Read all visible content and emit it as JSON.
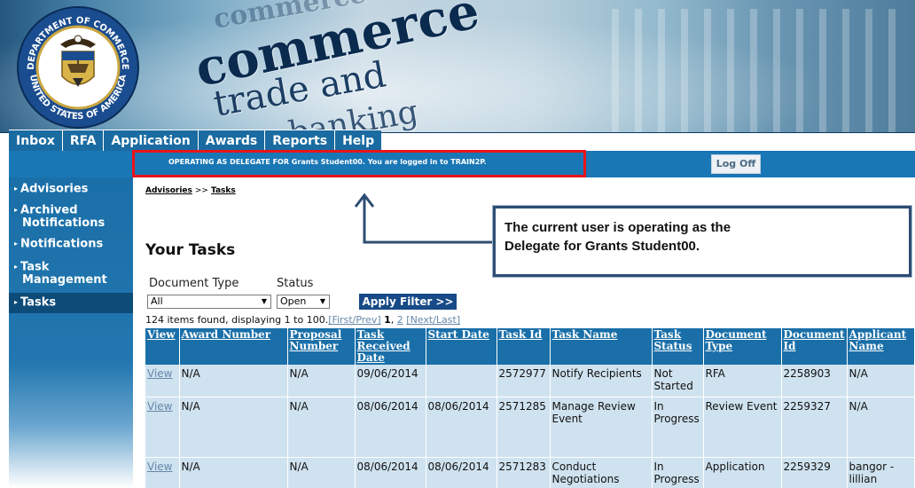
{
  "tabs": [
    {
      "label": "Inbox"
    },
    {
      "label": "RFA"
    },
    {
      "label": "Application"
    },
    {
      "label": "Awards"
    },
    {
      "label": "Reports"
    },
    {
      "label": "Help"
    }
  ],
  "banner": {
    "seal_top_text": "DEPARTMENT OF COMMERCE",
    "seal_bottom_text": "UNITED STATES OF AMERICA",
    "word_commerce": "commerce",
    "word_trade": "trade and",
    "word_banking": "banking"
  },
  "delegate_bar": {
    "message": "OPERATING AS DELEGATE FOR Grants Student00. You are logged in to TRAIN2P.",
    "logoff_label": "Log Off"
  },
  "sidebar": {
    "items": [
      {
        "line1": "Advisories",
        "line2": ""
      },
      {
        "line1": "Archived",
        "line2": "Notifications"
      },
      {
        "line1": "Notifications",
        "line2": ""
      },
      {
        "line1": "Task",
        "line2": "Management"
      },
      {
        "line1": "Tasks",
        "line2": ""
      }
    ]
  },
  "breadcrumb": {
    "parent": "Advisories",
    "separator": ">>",
    "current": "Tasks"
  },
  "page_title": "Your Tasks",
  "filters": {
    "document_type_label": "Document Type",
    "document_type_value": "All",
    "status_label": "Status",
    "status_value": "Open",
    "apply_label": "Apply Filter >>"
  },
  "pagination": {
    "summary": "124 items found, displaying 1 to 100.",
    "first_prev": "[First/Prev]",
    "current_page": "1",
    "comma": ",",
    "page2": "2",
    "next_last": "[Next/Last]"
  },
  "table": {
    "headers": [
      "View",
      "Award Number",
      "Proposal Number",
      "Task Received Date",
      "Start Date",
      "Task Id",
      "Task Name",
      "Task Status",
      "Document Type",
      "Document Id",
      "Applicant Name"
    ],
    "rows": [
      {
        "view": "View",
        "award_number": "N/A",
        "proposal_number": "N/A",
        "received": "09/06/2014",
        "start": "",
        "task_id": "2572977",
        "task_name": "Notify Recipients",
        "status": "Not Started",
        "doc_type": "RFA",
        "doc_id": "2258903",
        "applicant": "N/A"
      },
      {
        "view": "View",
        "award_number": "N/A",
        "proposal_number": "N/A",
        "received": "08/06/2014",
        "start": "08/06/2014",
        "task_id": "2571285",
        "task_name": "Manage Review Event",
        "status": "In Progress",
        "doc_type": "Review Event",
        "doc_id": "2259327",
        "applicant": "N/A"
      },
      {
        "view": "View",
        "award_number": "N/A",
        "proposal_number": "N/A",
        "received": "08/06/2014",
        "start": "08/06/2014",
        "task_id": "2571283",
        "task_name": "Conduct Negotiations",
        "status": "In Progress",
        "doc_type": "Application",
        "doc_id": "2259329",
        "applicant": "bangor - lillian"
      }
    ]
  },
  "callout": {
    "line1": "The current user is operating as the",
    "line2": "Delegate for Grants Student00."
  },
  "colors": {
    "nav_blue": "#1a6fa8",
    "table_row": "#cfe2ef",
    "highlight_red": "#e8141a",
    "callout_border": "#2e4d73",
    "apply_button": "#174a86"
  }
}
